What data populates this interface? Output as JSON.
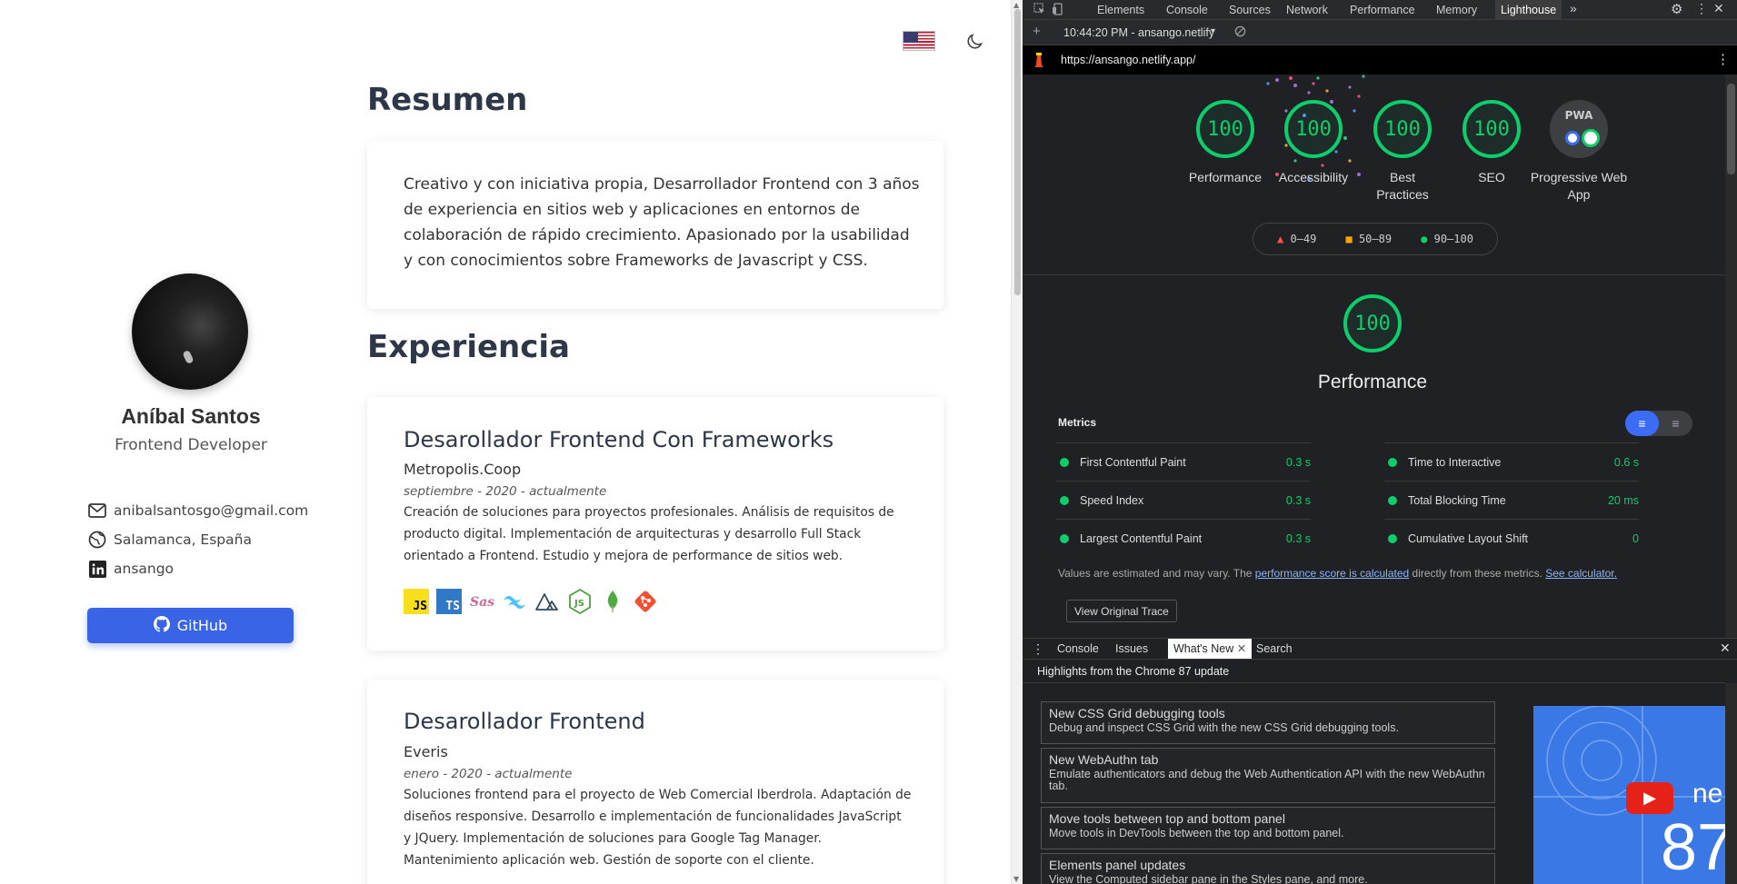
{
  "header": {
    "language_flag": "us-flag-icon",
    "theme_toggle": "moon-icon"
  },
  "profile": {
    "name": "Aníbal Santos",
    "role": "Frontend Developer",
    "email": "anibalsantosgo@gmail.com",
    "location": "Salamanca, España",
    "linkedin": "ansango",
    "github_label": "GitHub"
  },
  "summary": {
    "heading": "Resumen",
    "text": "Creativo y con iniciativa propia, Desarrollador Frontend con 3 años de experiencia en sitios web y aplicaciones en entornos de colaboración de rápido crecimiento. Apasionado por la usabilidad y con conocimientos sobre Frameworks de Javascript y CSS."
  },
  "experience": {
    "heading": "Experiencia",
    "jobs": [
      {
        "title": "Desarollador Frontend Con Frameworks",
        "company": "Metropolis.Coop",
        "dates": "septiembre - 2020 - actualmente",
        "description": "Creación de soluciones para proyectos profesionales. Análisis de requisitos de producto digital. Implementación de arquitecturas y desarrollo Full Stack orientado a Frontend. Estudio y mejora de performance de sitios web.",
        "techs": [
          "JS",
          "TS",
          "Sass",
          "Tailwind",
          "Nuxt",
          "Node",
          "MongoDB",
          "Git"
        ]
      },
      {
        "title": "Desarollador Frontend",
        "company": "Everis",
        "dates": "enero - 2020 - actualmente",
        "description": "Soluciones frontend para el proyecto de Web Comercial Iberdrola. Adaptación de diseños responsive. Desarrollo e implementación de funcionalidades JavaScript y JQuery. Implementación de soluciones para Google Tag Manager. Mantenimiento aplicación web. Gestión de soporte con el cliente."
      }
    ]
  },
  "devtools": {
    "tabs": [
      "Elements",
      "Console",
      "Sources",
      "Network",
      "Performance",
      "Memory",
      "Lighthouse"
    ],
    "active_tab": "Lighthouse",
    "report_select": "10:44:20 PM - ansango.netlify",
    "url": "https://ansango.netlify.app/",
    "gauges": [
      {
        "score": "100",
        "label": "Performance"
      },
      {
        "score": "100",
        "label": "Accessibility"
      },
      {
        "score": "100",
        "label": "Best Practices"
      },
      {
        "score": "100",
        "label": "SEO"
      },
      {
        "score": "PWA",
        "label": "Progressive Web App"
      }
    ],
    "legend": {
      "fail": "0–49",
      "average": "50–89",
      "pass": "90–100"
    },
    "main_score": "100",
    "main_label": "Performance",
    "metrics_heading": "Metrics",
    "metrics": [
      {
        "name": "First Contentful Paint",
        "value": "0.3 s"
      },
      {
        "name": "Time to Interactive",
        "value": "0.6 s"
      },
      {
        "name": "Speed Index",
        "value": "0.3 s"
      },
      {
        "name": "Total Blocking Time",
        "value": "20 ms"
      },
      {
        "name": "Largest Contentful Paint",
        "value": "0.3 s"
      },
      {
        "name": "Cumulative Layout Shift",
        "value": "0"
      }
    ],
    "note_prefix": "Values are estimated and may vary. The ",
    "note_link": "performance score is calculated",
    "note_mid": " directly from these metrics. ",
    "note_link2": "See calculator.",
    "trace_button": "View Original Trace",
    "drawer_tabs": [
      "Console",
      "Issues",
      "What's New",
      "Search"
    ],
    "drawer_active": "What's New",
    "drawer_header": "Highlights from the Chrome 87 update",
    "news": [
      {
        "title": "New CSS Grid debugging tools",
        "desc": "Debug and inspect CSS Grid with the new CSS Grid debugging tools."
      },
      {
        "title": "New WebAuthn tab",
        "desc": "Emulate authenticators and debug the Web Authentication API with the new WebAuthn tab."
      },
      {
        "title": "Move tools between top and bottom panel",
        "desc": "Move tools in DevTools between the top and bottom panel."
      },
      {
        "title": "Elements panel updates",
        "desc": "View the Computed sidebar pane in the Styles pane, and more."
      }
    ],
    "video_text_1": "ne",
    "video_text_2": "87"
  }
}
